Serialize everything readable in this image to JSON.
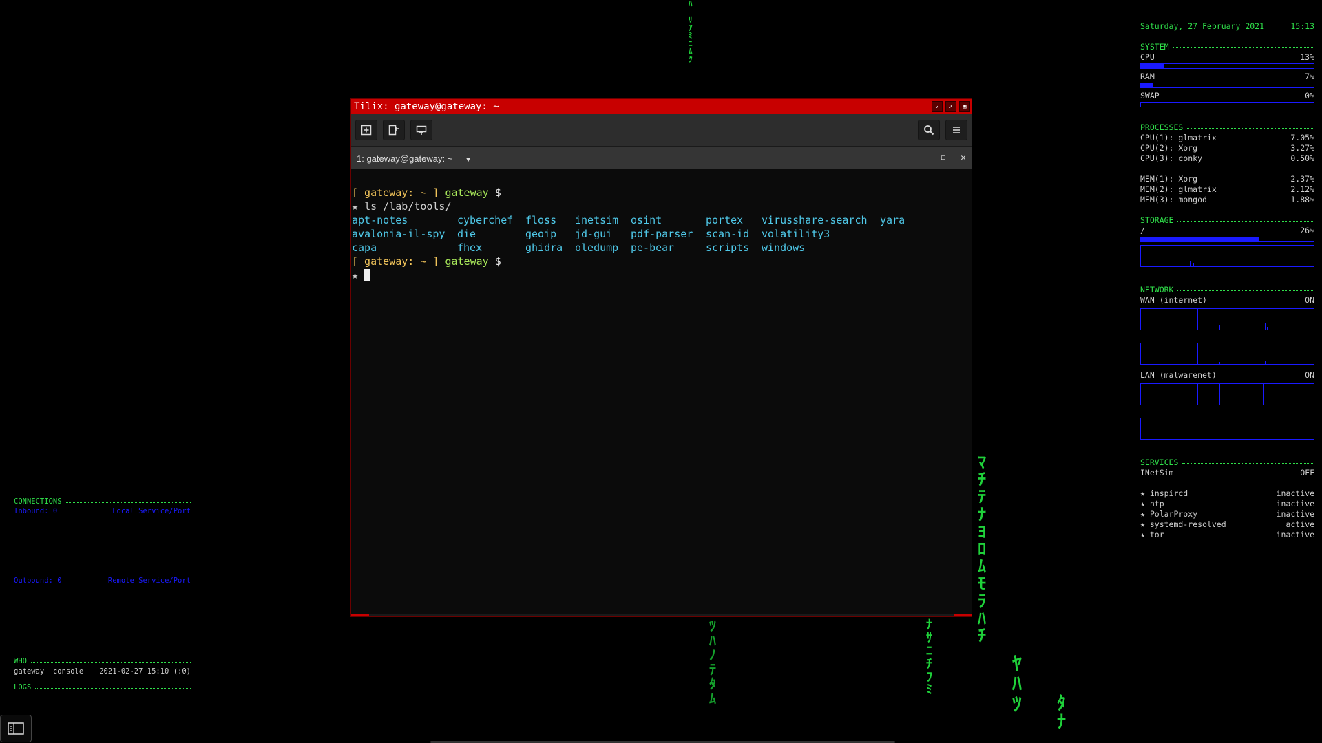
{
  "terminal": {
    "window_title": "Tilix: gateway@gateway: ~",
    "tab_title": "1: gateway@gateway: ~",
    "prompt_open": "[ gateway: ~ ]",
    "prompt_host": "gateway",
    "prompt_dollar": "$",
    "prompt_star": "★",
    "command": "ls /lab/tools/",
    "listing": [
      "apt-notes",
      "cyberchef",
      "floss",
      "inetsim",
      "osint",
      "portex",
      "virusshare-search",
      "yara",
      "avalonia-il-spy",
      "die",
      "geoip",
      "jd-gui",
      "pdf-parser",
      "scan-id",
      "volatility3",
      "",
      "capa",
      "fhex",
      "ghidra",
      "oledump",
      "pe-bear",
      "scripts",
      "windows",
      ""
    ]
  },
  "conky_right": {
    "date": "Saturday, 27 February 2021",
    "time": "15:13",
    "system": {
      "heading": "SYSTEM",
      "cpu_label": "CPU",
      "cpu_value": "13%",
      "cpu_fraction": 0.13,
      "ram_label": "RAM",
      "ram_value": "7%",
      "ram_fraction": 0.07,
      "swap_label": "SWAP",
      "swap_value": "0%",
      "swap_fraction": 0
    },
    "processes": {
      "heading": "PROCESSES",
      "cpu": [
        {
          "name": "CPU(1): glmatrix",
          "value": "7.05%"
        },
        {
          "name": "CPU(2): Xorg",
          "value": "3.27%"
        },
        {
          "name": "CPU(3): conky",
          "value": "0.50%"
        }
      ],
      "mem": [
        {
          "name": "MEM(1): Xorg",
          "value": "2.37%"
        },
        {
          "name": "MEM(2): glmatrix",
          "value": "2.12%"
        },
        {
          "name": "MEM(3): mongod",
          "value": "1.88%"
        }
      ]
    },
    "storage": {
      "heading": "STORAGE",
      "mount": "/",
      "value": "26%",
      "fraction": 0.68
    },
    "network": {
      "heading": "NETWORK",
      "wan_label": "WAN (internet)",
      "wan_state": "ON",
      "lan_label": "LAN (malwarenet)",
      "lan_state": "ON"
    },
    "services": {
      "heading": "SERVICES",
      "inetsim_label": "INetSim",
      "inetsim_state": "OFF",
      "list": [
        {
          "name": "★ inspircd",
          "state": "inactive"
        },
        {
          "name": "★ ntp",
          "state": "inactive"
        },
        {
          "name": "★ PolarProxy",
          "state": "inactive"
        },
        {
          "name": "★ systemd-resolved",
          "state": "active"
        },
        {
          "name": "★ tor",
          "state": "inactive"
        }
      ]
    }
  },
  "conky_left": {
    "connections_heading": "CONNECTIONS",
    "inbound": "Inbound: 0",
    "local_service": "Local Service/Port",
    "outbound": "Outbound: 0",
    "remote_service": "Remote Service/Port",
    "who_heading": "WHO",
    "who_user": "gateway",
    "who_tty": "console",
    "who_time": "2021-02-27 15:10 (:0)",
    "logs_heading": "LOGS"
  },
  "colors": {
    "accent_green": "#2fe04a",
    "accent_blue": "#1a1aff",
    "titlebar_red": "#c80000",
    "listing_cyan": "#4fc8e8"
  }
}
